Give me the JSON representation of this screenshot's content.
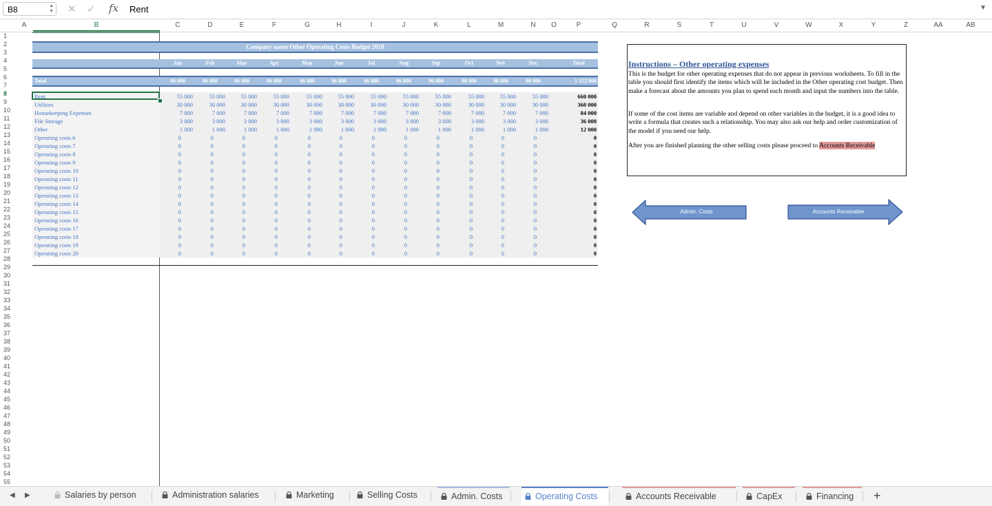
{
  "formula_bar": {
    "cell_ref": "B8",
    "value": "Rent"
  },
  "columns": [
    "A",
    "B",
    "C",
    "D",
    "E",
    "F",
    "G",
    "H",
    "I",
    "J",
    "K",
    "L",
    "M",
    "N",
    "O",
    "P",
    "Q",
    "R",
    "S",
    "T",
    "U",
    "V",
    "W",
    "X",
    "Y",
    "Z",
    "AA",
    "AB"
  ],
  "rows": [
    "1",
    "2",
    "3",
    "4",
    "5",
    "6",
    "7",
    "8",
    "9",
    "10",
    "11",
    "12",
    "13",
    "14",
    "15",
    "16",
    "17",
    "18",
    "19",
    "20",
    "21",
    "22",
    "23",
    "24",
    "25",
    "26",
    "27",
    "28",
    "29",
    "30",
    "31",
    "32",
    "33",
    "34",
    "35",
    "36",
    "37",
    "38",
    "39",
    "40",
    "41",
    "42",
    "43",
    "44",
    "45",
    "46",
    "47",
    "48",
    "49",
    "50",
    "51",
    "52",
    "53",
    "54",
    "55"
  ],
  "sheet": {
    "title": "Company name Other Operating Costs Budget 2018",
    "months": [
      "Jan",
      "Feb",
      "Mar",
      "Apr",
      "May",
      "Jun",
      "Jul",
      "Aug",
      "Sep",
      "Oct",
      "Nov",
      "Dec"
    ],
    "total_header": "Total",
    "total_row": {
      "label": "Total",
      "values": [
        "96 000",
        "96 000",
        "96 000",
        "96 000",
        "96 000",
        "96 000",
        "96 000",
        "96 000",
        "96 000",
        "96 000",
        "96 000",
        "96 000"
      ],
      "total": "1 152 000"
    },
    "lines": [
      {
        "label": "Rent",
        "value": "55 000",
        "total": "660 000"
      },
      {
        "label": "Utilities",
        "value": "30 000",
        "total": "360 000"
      },
      {
        "label": "Housekeeping Expenses",
        "value": "7 000",
        "total": "84 000"
      },
      {
        "label": "File Storage",
        "value": "3 000",
        "total": "36 000"
      },
      {
        "label": "Other",
        "value": "1 000",
        "total": "12 000"
      },
      {
        "label": "Operating costs 6",
        "value": "0",
        "total": "0"
      },
      {
        "label": "Operating costs 7",
        "value": "0",
        "total": "0"
      },
      {
        "label": "Operating costs 8",
        "value": "0",
        "total": "0"
      },
      {
        "label": "Operating costs 9",
        "value": "0",
        "total": "0"
      },
      {
        "label": "Operating costs 10",
        "value": "0",
        "total": "0"
      },
      {
        "label": "Operating costs 11",
        "value": "0",
        "total": "0"
      },
      {
        "label": "Operating costs 12",
        "value": "0",
        "total": "0"
      },
      {
        "label": "Operating costs 13",
        "value": "0",
        "total": "0"
      },
      {
        "label": "Operating costs 14",
        "value": "0",
        "total": "0"
      },
      {
        "label": "Operating costs 15",
        "value": "0",
        "total": "0"
      },
      {
        "label": "Operating costs 16",
        "value": "0",
        "total": "0"
      },
      {
        "label": "Operating costs 17",
        "value": "0",
        "total": "0"
      },
      {
        "label": "Operating costs 18",
        "value": "0",
        "total": "0"
      },
      {
        "label": "Operating costs 19",
        "value": "0",
        "total": "0"
      },
      {
        "label": "Operating costs 20",
        "value": "0",
        "total": "0"
      }
    ]
  },
  "instructions": {
    "title": "Instructions – Other operating expenses",
    "p1": "This is the budget for other operating expenses that do not appear in previous worksheets. To fill in the table you should first identify the items which will be included in the Other operating cost budget. Then make a forecast about the amounts you plan to spend each month and input the numbers into the table.",
    "p2": "If some of the cost items are variable and depend on other variables in the budget, it is a good idea to write a formula that creates such a relationship. You may also ask our help and order customization of the model if you need our help.",
    "p3_prefix": "After you are finished planning the other selling costs please proceed to ",
    "p3_link": "Accounts Receivable"
  },
  "nav_buttons": {
    "back": "Admin. Costs",
    "forward": "Accounts Receivable"
  },
  "tabs": [
    {
      "label": "Salaries by person",
      "locked": true
    },
    {
      "label": "Administration salaries",
      "locked": true
    },
    {
      "label": "Marketing",
      "locked": true
    },
    {
      "label": "Selling Costs",
      "locked": true
    },
    {
      "label": "Admin. Costs",
      "locked": true
    },
    {
      "label": "Operating Costs",
      "locked": true,
      "active": true
    },
    {
      "label": "Accounts Receivable",
      "locked": true
    },
    {
      "label": "CapEx",
      "locked": true
    },
    {
      "label": "Financing",
      "locked": true
    }
  ],
  "colors": {
    "accent": "#217346",
    "header_band": "#a6c0e0",
    "band_border": "#4a6fa5",
    "input_text": "#4472c4",
    "highlight": "#e39a9a",
    "active_tab": "#5a7fc7"
  }
}
